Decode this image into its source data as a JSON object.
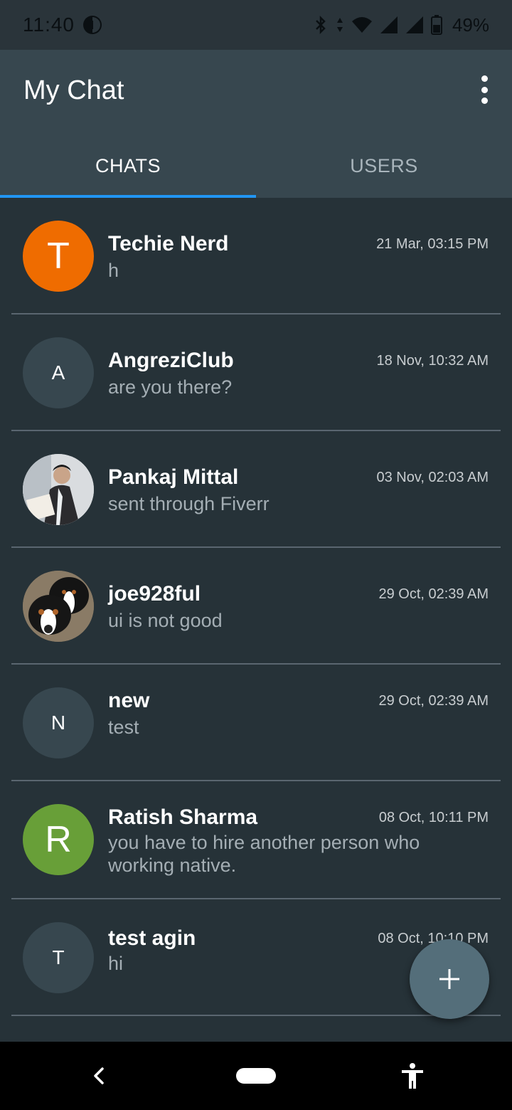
{
  "status_bar": {
    "time": "11:40",
    "battery": "49%",
    "icons": [
      "data-saver-icon",
      "bluetooth-icon",
      "data-arrows-icon",
      "wifi-icon",
      "signal-icon",
      "signal-icon",
      "battery-icon"
    ]
  },
  "app_bar": {
    "title": "My Chat",
    "menu_icon": "overflow-menu-icon"
  },
  "tabs": [
    {
      "label": "CHATS",
      "active": true
    },
    {
      "label": "USERS",
      "active": false
    }
  ],
  "chats": [
    {
      "name": "Techie Nerd",
      "preview": "h",
      "time": "21 Mar, 03:15 PM",
      "avatar_letter": "T",
      "avatar_color": "#ef6c00",
      "avatar_style": "big"
    },
    {
      "name": "AngreziClub",
      "preview": "are you there?",
      "time": "18 Nov, 10:32 AM",
      "avatar_letter": "A",
      "avatar_color": "#37474f",
      "avatar_style": "small"
    },
    {
      "name": "Pankaj Mittal",
      "preview": "sent through Fiverr",
      "time": "03 Nov, 02:03 AM",
      "avatar_letter": "",
      "avatar_color": "#cfd3d6",
      "avatar_style": "photo-man"
    },
    {
      "name": "joe928ful",
      "preview": "ui is not good",
      "time": "29 Oct, 02:39 AM",
      "avatar_letter": "",
      "avatar_color": "#7a6a55",
      "avatar_style": "photo-dog"
    },
    {
      "name": "new",
      "preview": "test",
      "time": "29 Oct, 02:39 AM",
      "avatar_letter": "N",
      "avatar_color": "#37474f",
      "avatar_style": "small"
    },
    {
      "name": "Ratish Sharma",
      "preview": "you have to hire another person who working native.",
      "time": "08 Oct, 10:11 PM",
      "avatar_letter": "R",
      "avatar_color": "#689f38",
      "avatar_style": "big"
    },
    {
      "name": "test agin",
      "preview": "hi",
      "time": "08 Oct, 10:10 PM",
      "avatar_letter": "T",
      "avatar_color": "#37474f",
      "avatar_style": "small"
    }
  ],
  "fab": {
    "icon": "add-icon"
  },
  "nav_bar": {
    "icons": [
      "back-icon",
      "home-pill-icon",
      "accessibility-icon"
    ]
  },
  "colors": {
    "background": "#263238",
    "app_bar": "#37474f",
    "tab_indicator": "#2196f3",
    "fab": "#546e7a"
  }
}
